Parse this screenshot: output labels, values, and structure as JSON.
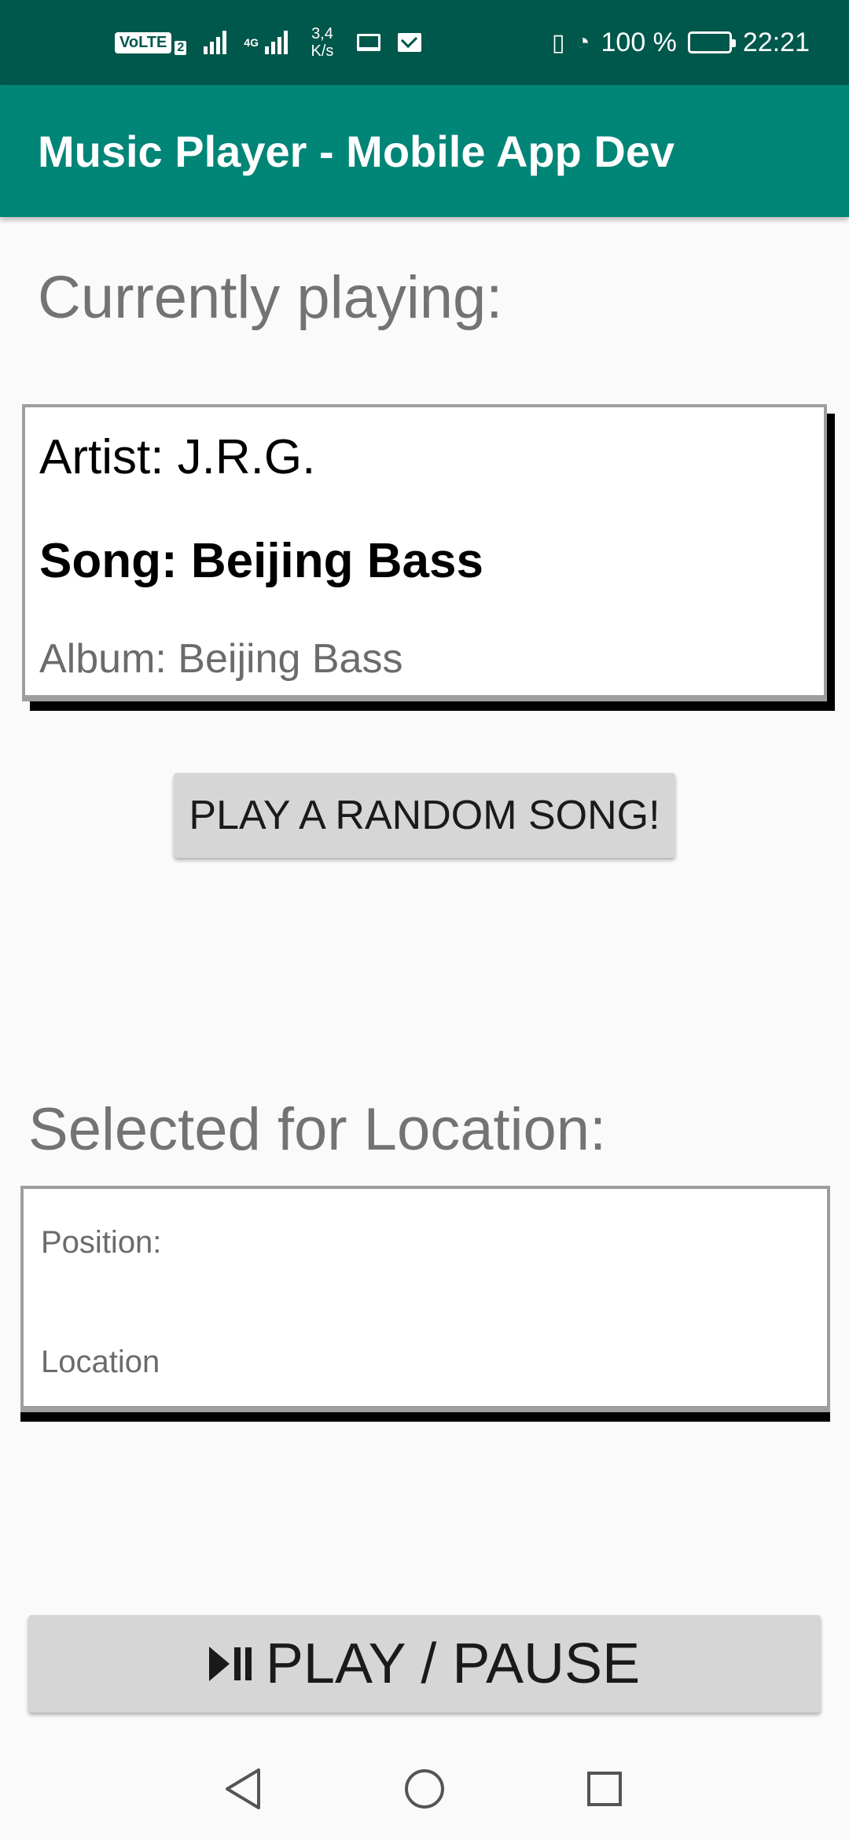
{
  "status_bar": {
    "volte_label": "VoLTE",
    "sim_label": "2",
    "network_label": "4G",
    "speed_value": "3,4",
    "speed_unit": "K/s",
    "battery_percent": "100 %",
    "time": "22:21",
    "icons": [
      "volte-icon",
      "signal-icon",
      "4g-signal-icon",
      "laptop-icon",
      "mail-icon",
      "vibrate-icon",
      "speedometer-icon",
      "battery-icon"
    ]
  },
  "app_bar": {
    "title": "Music Player - Mobile App Dev",
    "color": "#008577"
  },
  "now_playing": {
    "heading": "Currently playing:",
    "artist": "Artist: J.R.G.",
    "song": "Song: Beijing Bass",
    "album": "Album: Beijing Bass"
  },
  "random_button": {
    "label": "PLAY A RANDOM SONG!"
  },
  "location": {
    "heading": "Selected for Location:",
    "position_label": "Position:",
    "location_label": "Location"
  },
  "play_pause_button": {
    "label": "PLAY / PAUSE",
    "icon": "play-pause-icon"
  },
  "nav_bar": {
    "icons": [
      "back-icon",
      "home-icon",
      "recent-apps-icon"
    ]
  }
}
